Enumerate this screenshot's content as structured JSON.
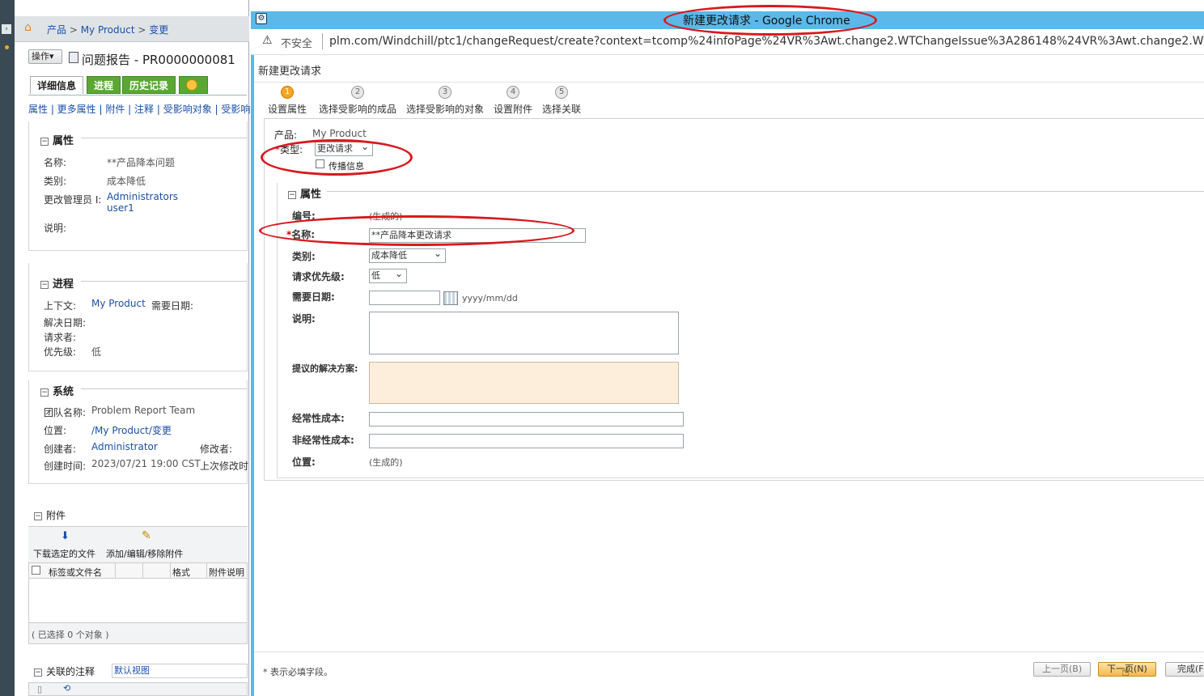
{
  "left_panel": {
    "breadcrumb": [
      "产品",
      "My Product",
      "变更"
    ],
    "actions_label": "操作",
    "doc_title": "问题报告 - PR0000000081",
    "tabs": [
      "详细信息",
      "进程",
      "历史记录"
    ],
    "subnav": "属性 | 更多属性 | 附件 | 注释 | 受影响对象 | 受影响",
    "attributes": {
      "title": "属性",
      "name_label": "名称:",
      "name_value": "**产品降本问题",
      "category_label": "类别:",
      "category_value": "成本降低",
      "manager_label": "更改管理员 I:",
      "manager_value_1": "Administrators",
      "manager_value_2": "user1",
      "desc_label": "说明:"
    },
    "process": {
      "title": "进程",
      "context_label": "上下文:",
      "context_value": "My Product",
      "need_date_label": "需要日期:",
      "resolve_date_label": "解决日期:",
      "requester_label": "请求者:",
      "priority_label": "优先级:",
      "priority_value": "低"
    },
    "system": {
      "title": "系统",
      "team_label": "团队名称:",
      "team_value": "Problem Report Team",
      "location_label": "位置:",
      "location_value": "/My Product/变更",
      "creator_label": "创建者:",
      "creator_value": "Administrator",
      "modifier_label": "修改者:",
      "created_label": "创建时间:",
      "created_value": "2023/07/21 19:00 CST",
      "modified_label": "上次修改时"
    },
    "attachments": {
      "title": "附件",
      "download_label": "下载选定的文件",
      "edit_label": "添加/编辑/移除附件",
      "col_name": "标签或文件名",
      "col_format": "格式",
      "col_desc": "附件说明",
      "selected": "( 已选择 0 个对象 )"
    },
    "notes": {
      "title": "关联的注释",
      "view": "默认视图"
    }
  },
  "chrome": {
    "title": "新建更改请求 - Google Chrome",
    "insecure": "不安全",
    "url": "plm.com/Windchill/ptc1/changeRequest/create?context=tcomp%24infoPage%24VR%3Awt.change2.WTChangeIssue%3A286148%24VR%3Awt.change2.WTChang"
  },
  "dialog": {
    "heading": "新建更改请求",
    "steps": [
      {
        "num": "1",
        "label": "设置属性"
      },
      {
        "num": "2",
        "label": "选择受影响的成品"
      },
      {
        "num": "3",
        "label": "选择受影响的对象"
      },
      {
        "num": "4",
        "label": "设置附件"
      },
      {
        "num": "5",
        "label": "选择关联"
      }
    ],
    "product_label": "产品:",
    "product_value": "My Product",
    "type_label": "类型:",
    "type_value": "更改请求",
    "propagate_label": "传播信息",
    "attr_title": "属性",
    "number_label": "编号:",
    "number_value": "(生成的)",
    "name_label": "名称:",
    "name_value": "**产品降本更改请求",
    "category_label": "类别:",
    "category_value": "成本降低",
    "priority_label": "请求优先级:",
    "priority_value": "低",
    "need_date_label": "需要日期:",
    "date_format": "yyyy/mm/dd",
    "desc_label": "说明:",
    "solution_label": "提议的解决方案:",
    "recurring_label": "经常性成本:",
    "nonrecurring_label": "非经常性成本:",
    "location_label": "位置:",
    "location_value": "(生成的)",
    "required_note": "* 表示必填字段。",
    "prev_button": "上一页(B)",
    "next_button": "下一页(N)",
    "finish_button": "完成(F"
  },
  "colors": {
    "titlebar": "#5bb8e9",
    "annotation": "#d8191f",
    "link": "#1a50a6",
    "tab_green": "#5aa832"
  }
}
